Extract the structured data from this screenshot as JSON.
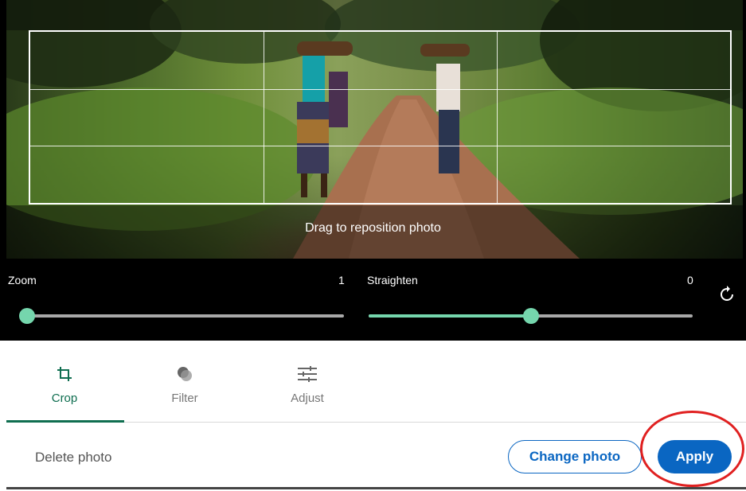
{
  "photo": {
    "drag_hint": "Drag to reposition photo"
  },
  "sliders": {
    "zoom": {
      "label": "Zoom",
      "value": "1",
      "fraction": 0.0
    },
    "straighten": {
      "label": "Straighten",
      "value": "0",
      "fraction": 0.5
    }
  },
  "tabs": [
    {
      "label": "Crop",
      "icon": "crop-icon",
      "active": true
    },
    {
      "label": "Filter",
      "icon": "filter-icon",
      "active": false
    },
    {
      "label": "Adjust",
      "icon": "adjust-icon",
      "active": false
    }
  ],
  "footer": {
    "delete_label": "Delete photo",
    "change_label": "Change photo",
    "apply_label": "Apply"
  },
  "colors": {
    "accent_green": "#75d6ad",
    "tab_active": "#0f6e50",
    "primary_blue": "#0a66c2",
    "highlight_red": "#e02020"
  }
}
